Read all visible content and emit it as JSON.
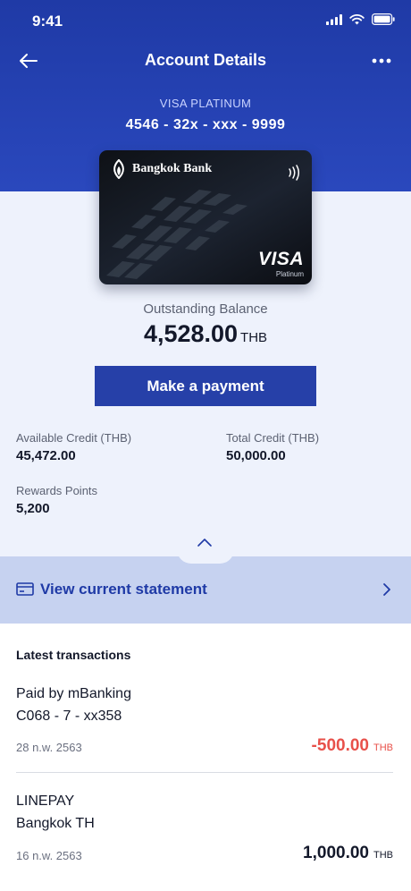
{
  "status_bar": {
    "time": "9:41"
  },
  "nav": {
    "title": "Account Details"
  },
  "card": {
    "type": "VISA PLATINUM",
    "number": "4546 - 32x - xxx - 9999",
    "bank_name": "Bangkok Bank",
    "network": "VISA",
    "tier": "Platinum"
  },
  "balance": {
    "label": "Outstanding Balance",
    "amount": "4,528.00",
    "currency": "THB"
  },
  "actions": {
    "pay_label": "Make a payment"
  },
  "stats": {
    "available_label": "Available Credit (THB)",
    "available_value": "45,472.00",
    "total_label": "Total Credit (THB)",
    "total_value": "50,000.00",
    "rewards_label": "Rewards Points",
    "rewards_value": "5,200"
  },
  "statement": {
    "label": "View current statement"
  },
  "transactions": {
    "heading": "Latest transactions",
    "items": [
      {
        "line1": "Paid by mBanking",
        "line2": "C068 - 7 - xx358",
        "date": "28 n.w. 2563",
        "amount": "-500.00",
        "currency": "THB",
        "color": "#e8504a"
      },
      {
        "line1": "LINEPAY",
        "line2": "Bangkok TH",
        "date": "16 n.w. 2563",
        "amount": "1,000.00",
        "currency": "THB",
        "color": "#13182a"
      }
    ]
  },
  "colors": {
    "primary": "#2640a8",
    "header": "#1f3aa6",
    "negative": "#e8504a",
    "statement_bg": "#c6d2f0"
  }
}
